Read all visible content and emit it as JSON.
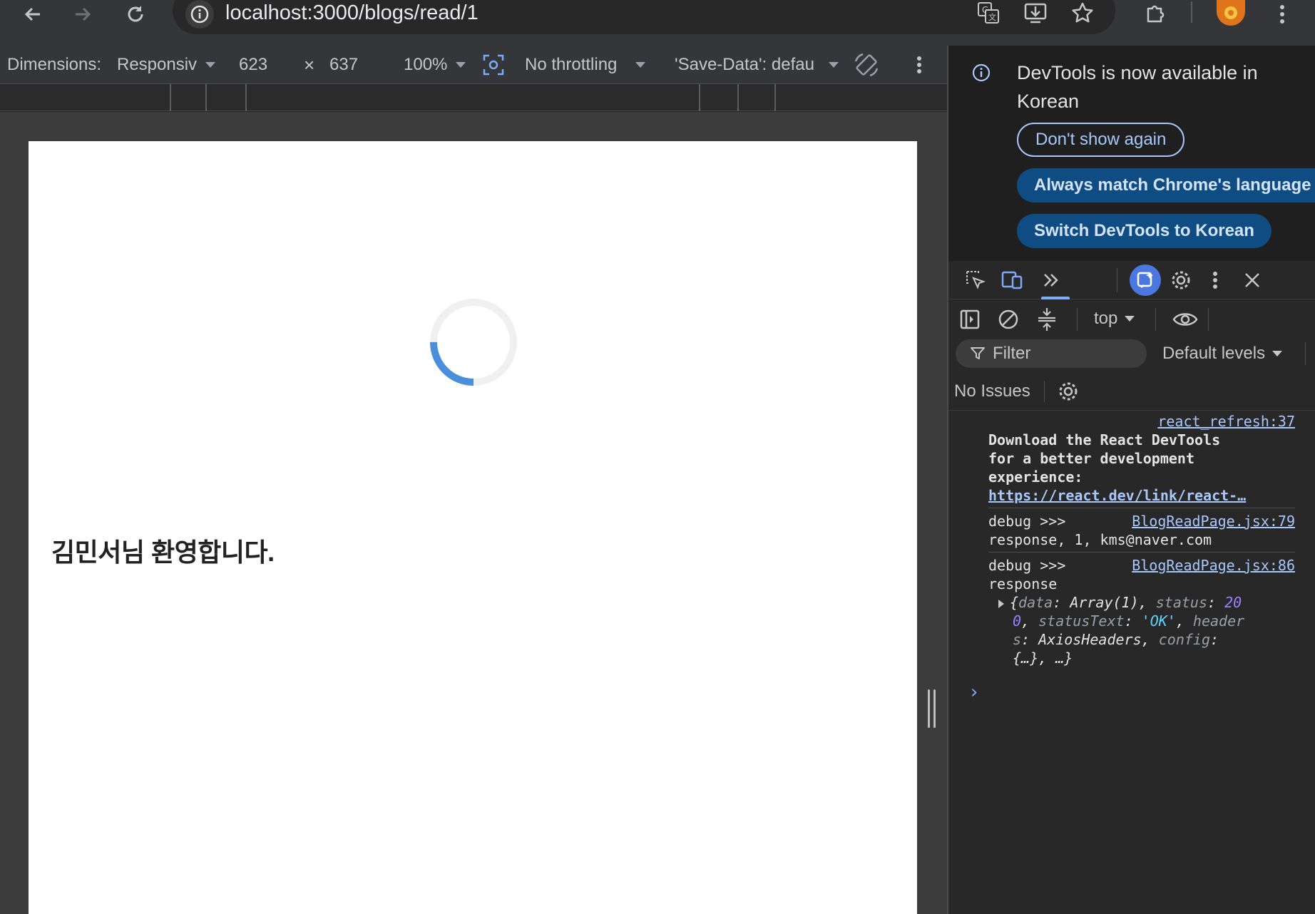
{
  "browser": {
    "url": "localhost:3000/blogs/read/1"
  },
  "device_toolbar": {
    "dimensions_label": "Dimensions:",
    "device": "Responsiv",
    "width": "623",
    "times": "×",
    "height": "637",
    "zoom": "100%",
    "throttling": "No throttling",
    "save_data": "'Save-Data': defau"
  },
  "page": {
    "welcome_text": "김민서님 환영합니다.",
    "spinner_progress": 0.25,
    "spinner_color": "#4a8fdb"
  },
  "devtools": {
    "infobar": {
      "message": "DevTools is now available in Korean",
      "dont_show": "Don't show again",
      "always_match": "Always match Chrome's language",
      "switch": "Switch DevTools to Korean"
    },
    "console_toolbar": {
      "context": "top",
      "filter_placeholder": "Filter",
      "levels": "Default levels"
    },
    "issues": "No Issues",
    "messages": [
      {
        "source": "react_refresh:37",
        "line1": "Download the React DevTools",
        "line2": "for a better development",
        "line3": "experience:",
        "link": "https://react.dev/link/react-…"
      },
      {
        "source": "BlogReadPage.jsx:79",
        "prefix": "debug >>>",
        "text": "response, 1, kms@naver.com"
      },
      {
        "source": "BlogReadPage.jsx:86",
        "prefix": "debug >>>",
        "text": "response",
        "obj_line1_k1": "data",
        "obj_line1_v1": "Array(1)",
        "obj_line1_k2": "status",
        "obj_line1_v2a": "20",
        "obj_line2_v2b": "0",
        "obj_line2_k3": "statusText",
        "obj_line2_v3": "'OK'",
        "obj_line2_k4a": "header",
        "obj_line3_k4b": "s",
        "obj_line3_v4": "AxiosHeaders",
        "obj_line3_k5": "config",
        "obj_line4": "{…}, …}"
      }
    ],
    "prompt": "›"
  }
}
